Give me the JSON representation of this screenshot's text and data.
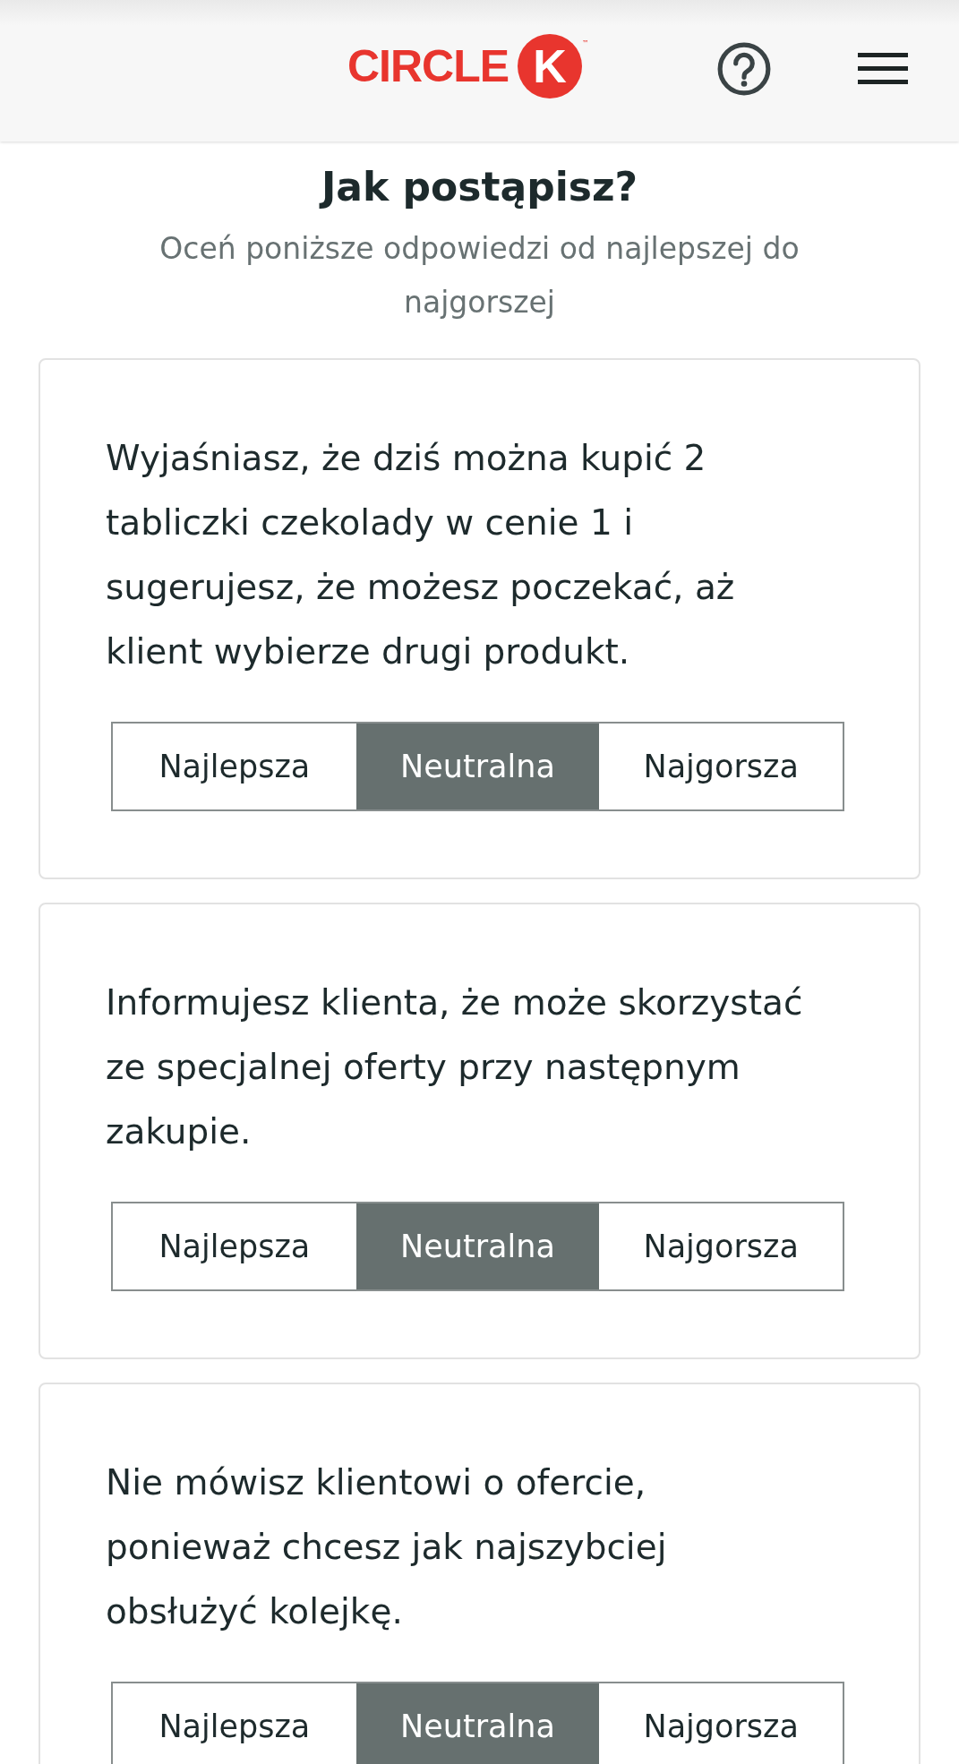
{
  "header": {
    "logo": {
      "text": "CIRCLE",
      "mark": "K",
      "trademark": "™"
    }
  },
  "title": "Jak postąpisz?",
  "subtitle": "Oceń poniższe odpowiedzi od najlepszej do najgorszej",
  "answers": [
    {
      "text": "Wyjaśniasz, że dziś można kupić 2 tabliczki czekolady w cenie 1 i sugerujesz, że możesz poczekać, aż klient wybierze drugi produkt.",
      "options": [
        {
          "label": "Najlepsza",
          "selected": false
        },
        {
          "label": "Neutralna",
          "selected": true
        },
        {
          "label": "Najgorsza",
          "selected": false
        }
      ]
    },
    {
      "text": "Informujesz klienta, że może skorzystać ze specjalnej oferty przy następnym zakupie.",
      "options": [
        {
          "label": "Najlepsza",
          "selected": false
        },
        {
          "label": "Neutralna",
          "selected": true
        },
        {
          "label": "Najgorsza",
          "selected": false
        }
      ]
    },
    {
      "text": "Nie mówisz klientowi o ofercie, ponieważ chcesz jak najszybciej obsłużyć kolejkę.",
      "options": [
        {
          "label": "Najlepsza",
          "selected": false
        },
        {
          "label": "Neutralna",
          "selected": true
        },
        {
          "label": "Najgorsza",
          "selected": false
        }
      ]
    }
  ]
}
